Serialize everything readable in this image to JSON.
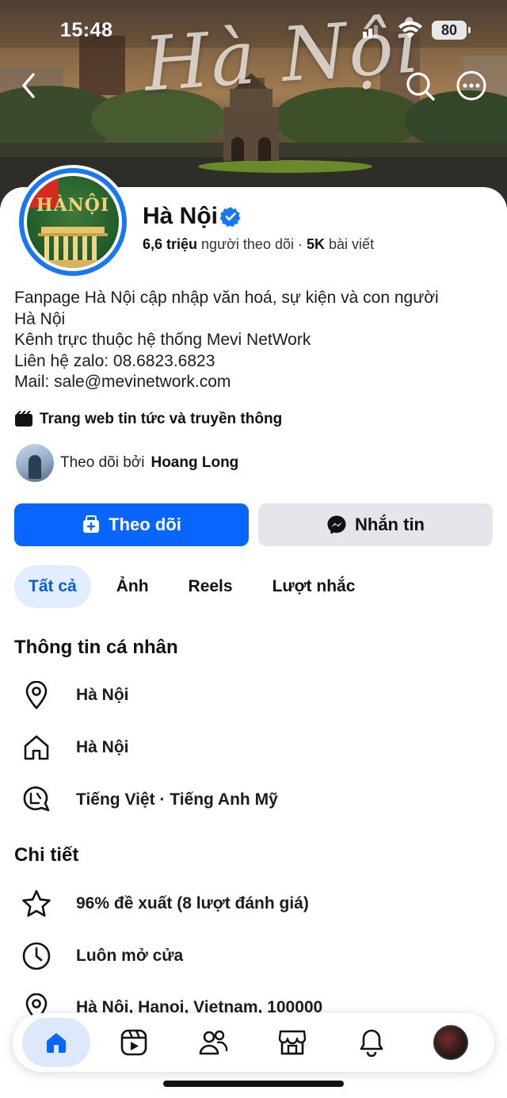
{
  "status_bar": {
    "time": "15:48",
    "battery": "80"
  },
  "cover": {
    "title": "Hà Nội"
  },
  "avatar": {
    "text": "HÀNỘI"
  },
  "profile": {
    "name": "Hà Nội",
    "followers_count": "6,6 triệu",
    "followers_label": "người theo dõi",
    "posts_count": "5K",
    "posts_label": "bài viết",
    "bio": [
      "Fanpage Hà Nội cập nhập văn hoá, sự kiện và con người",
      "Hà Nội",
      "Kênh trực thuộc hệ thống Mevi NetWork",
      "Liên hệ zalo: 08.6823.6823",
      "Mail: sale@mevinetwork.com"
    ],
    "category": "Trang web tin tức và truyền thông",
    "followed_by_prefix": "Theo dõi bởi",
    "followed_by_name": "Hoang Long"
  },
  "actions": {
    "follow": "Theo dõi",
    "message": "Nhắn tin"
  },
  "tabs": [
    "Tất cả",
    "Ảnh",
    "Reels",
    "Lượt nhắc"
  ],
  "personal_info": {
    "title": "Thông tin cá nhân",
    "items": [
      {
        "icon": "location-pin-icon",
        "text": "Hà Nội"
      },
      {
        "icon": "home-icon",
        "text": "Hà Nội"
      },
      {
        "icon": "language-icon",
        "text": "Tiếng Việt · Tiếng Anh Mỹ"
      }
    ]
  },
  "details": {
    "title": "Chi tiết",
    "items": [
      {
        "icon": "star-icon",
        "text": "96% đề xuất (8 lượt đánh giá)"
      },
      {
        "icon": "clock-icon",
        "text": "Luôn mở cửa"
      },
      {
        "icon": "location-pin-icon",
        "text": "Hà Nội, Hanoi, Vietnam, 100000"
      }
    ]
  },
  "colors": {
    "accent": "#0866ff",
    "verified": "#1877f2",
    "tab_active_bg": "#e3eefc"
  },
  "bottom_nav": [
    "home-icon",
    "reels-icon",
    "friends-icon",
    "marketplace-icon",
    "bell-icon",
    "profile-avatar"
  ]
}
